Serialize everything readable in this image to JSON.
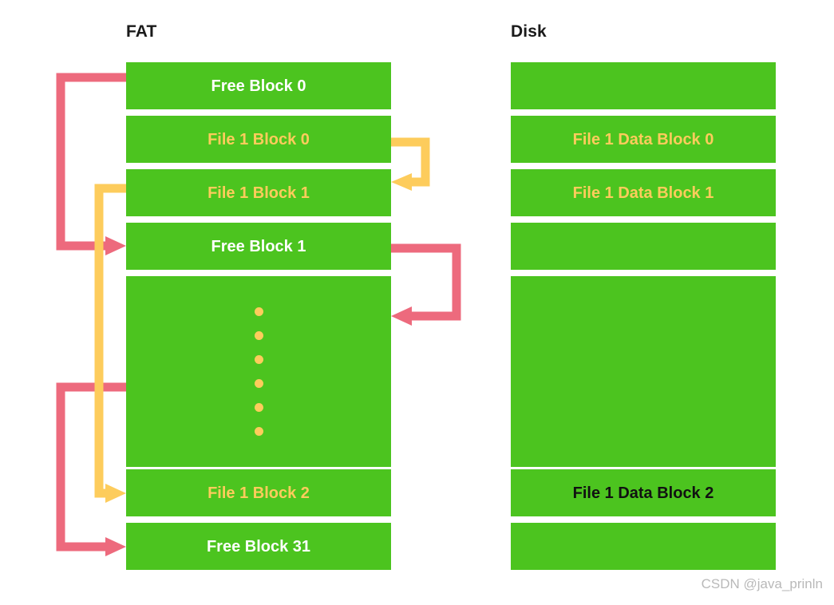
{
  "columns": {
    "fat": {
      "header": "FAT",
      "blocks": [
        {
          "label": "Free Block 0",
          "style": "t-white"
        },
        {
          "label": "File 1 Block 0",
          "style": "t-yellow"
        },
        {
          "label": "File 1 Block 1",
          "style": "t-yellow"
        },
        {
          "label": "Free Block 1",
          "style": "t-white"
        },
        {
          "label": "",
          "style": "t-white"
        },
        {
          "label": "File 1 Block 2",
          "style": "t-yellow"
        },
        {
          "label": "Free Block 31",
          "style": "t-white"
        }
      ]
    },
    "disk": {
      "header": "Disk",
      "blocks": [
        {
          "label": "",
          "style": "t-white"
        },
        {
          "label": "File 1 Data Block 0",
          "style": "t-yellow"
        },
        {
          "label": "File 1 Data Block 1",
          "style": "t-yellow"
        },
        {
          "label": "",
          "style": "t-white"
        },
        {
          "label": "",
          "style": "t-white"
        },
        {
          "label": "File 1 Data Block 2",
          "style": "t-black"
        },
        {
          "label": "",
          "style": "t-white"
        }
      ]
    }
  },
  "ellipsis": {
    "dot_count": 6,
    "name": "vertical-ellipsis"
  },
  "arrows": [
    {
      "name": "free-block-0-to-free-block-1",
      "color": "#ED6A7D",
      "kind": "free-chain"
    },
    {
      "name": "free-block-1-to-middle-block",
      "color": "#ED6A7D",
      "kind": "free-chain"
    },
    {
      "name": "middle-block-to-free-block-31",
      "color": "#ED6A7D",
      "kind": "free-chain"
    },
    {
      "name": "file-1-block-0-to-file-1-block-1",
      "color": "#FDCC5C",
      "kind": "file-chain"
    },
    {
      "name": "file-1-block-1-to-file-1-block-2",
      "color": "#FDCC5C",
      "kind": "file-chain"
    }
  ],
  "colors": {
    "block_green": "#4CC41F",
    "free_arrow_red": "#ED6A7D",
    "file_arrow_yellow": "#FDCC5C",
    "background": "#FFFFFF",
    "watermark_gray": "#B9B9B9"
  },
  "watermark": "CSDN @java_prinln"
}
